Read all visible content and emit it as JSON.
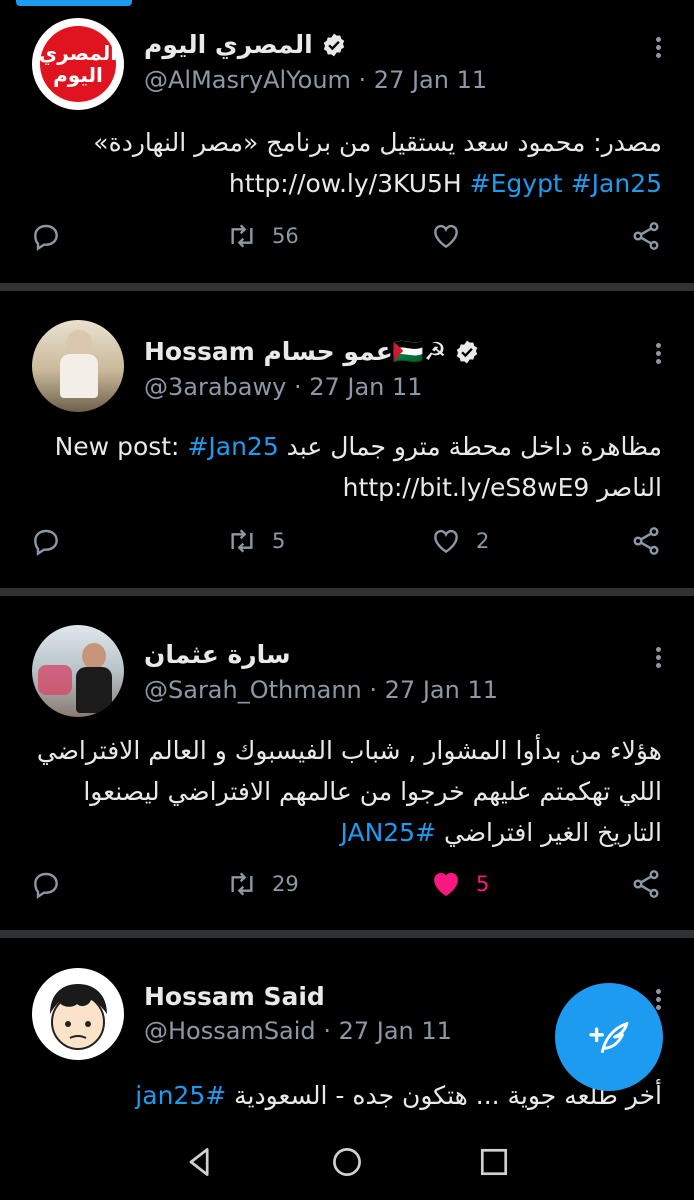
{
  "colors": {
    "accent": "#1d9bf0",
    "like": "#f91880",
    "muted": "#8b98a5",
    "background": "#000000"
  },
  "tweets": [
    {
      "name": "المصري اليوم",
      "verified": true,
      "handle": "@AlMasryAlYoum",
      "date": "· 27 Jan 11",
      "avatar_text_line1": "المصري",
      "avatar_text_line2": "اليوم",
      "text_line1": "مصدر: محمود سعد يستقيل من برنامج «مصر النهاردة»",
      "text_line2_plain": "http://ow.ly/3KU5H ",
      "hashtags": [
        "#Egypt",
        "#Jan25"
      ],
      "retweets": "56",
      "likes": ""
    },
    {
      "name": "Hossam عمو حسام🇵🇸☭",
      "verified": true,
      "handle": "@3arabawy",
      "date": "· 27 Jan 11",
      "text_line1_plain": "مظاهرة داخل محطة مترو جمال عبد New post: ",
      "text_line1_tag": "#Jan25",
      "text_line2": "الناصر http://bit.ly/eS8wE9",
      "retweets": "5",
      "likes": "2"
    },
    {
      "name": "سارة عثمان",
      "verified": false,
      "handle": "@Sarah_Othmann",
      "date": "· 27 Jan 11",
      "text_line1": "هؤلاء من  بدأوا المشوار , شباب الفيسبوك و العالم الافتراضي",
      "text_line2": "اللي تهكمتم عليهم خرجوا من عالمهم الافتراضي ليصنعوا",
      "text_line3_plain": "التاريخ الغير افتراضي ",
      "text_line3_tag": "#JAN25",
      "retweets": "29",
      "likes": "5",
      "liked": true
    },
    {
      "name": "Hossam Said",
      "verified": false,
      "handle": "@HossamSaid",
      "date": "· 27 Jan 11",
      "text_line1_plain": "أخر طلعه جوية  ... هتكون جده - السعودية ",
      "text_line1_tag": "#jan25"
    }
  ],
  "icons": [
    "reply-icon",
    "retweet-icon",
    "like-icon",
    "share-icon",
    "more-icon",
    "verified-icon",
    "compose-icon",
    "back-icon",
    "home-icon",
    "recents-icon"
  ]
}
